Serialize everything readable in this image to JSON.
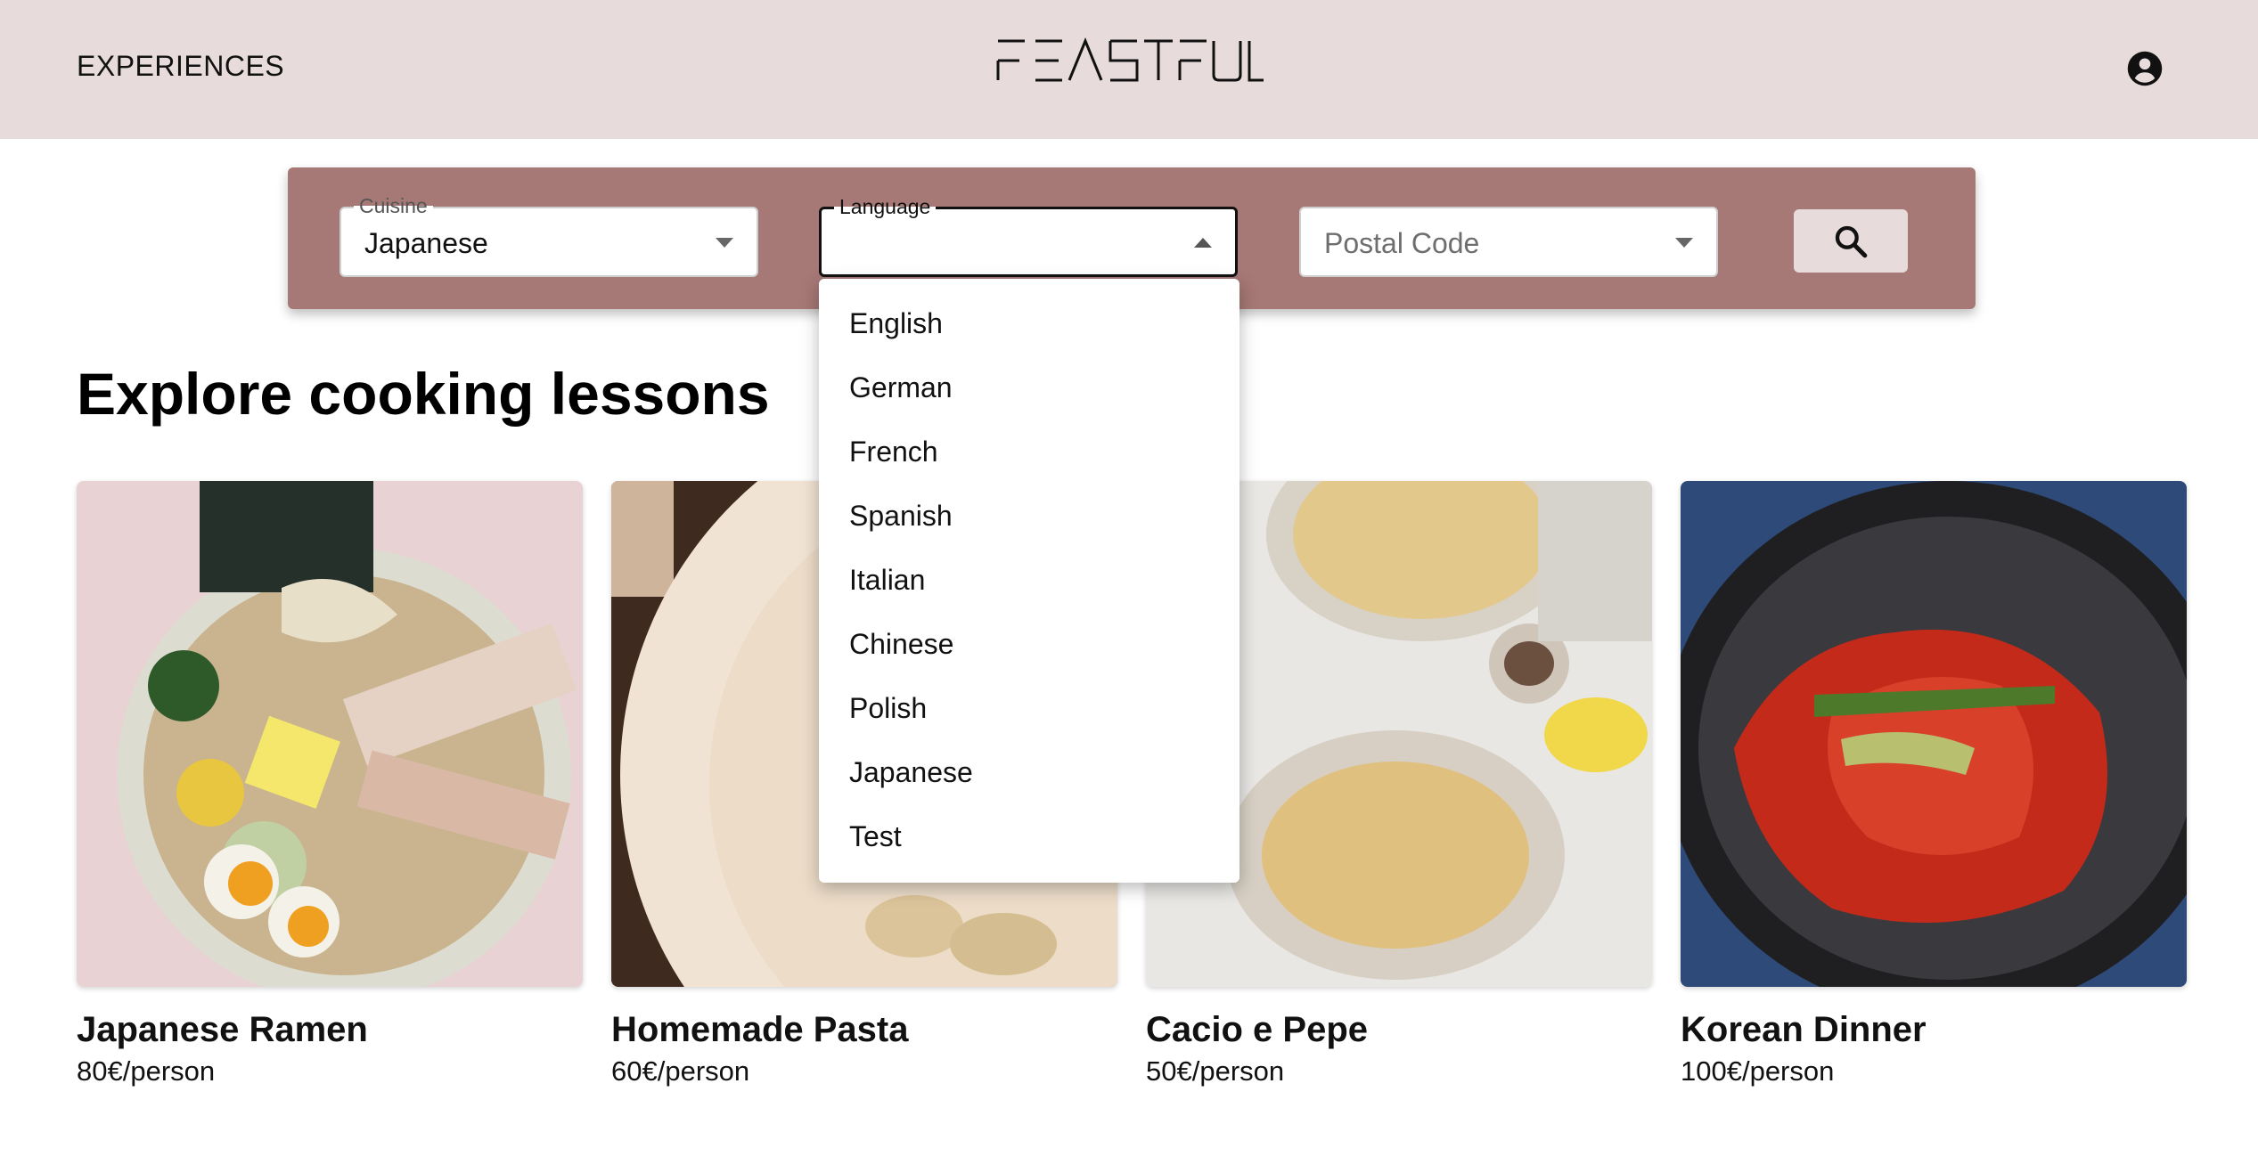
{
  "header": {
    "nav_link": "EXPERIENCES",
    "logo_text": "FEASTFUL",
    "account_icon": "account-circle-icon"
  },
  "search": {
    "cuisine": {
      "label": "Cuisine",
      "value": "Japanese"
    },
    "language": {
      "label": "Language",
      "value": ""
    },
    "postal_code": {
      "placeholder": "Postal Code"
    },
    "search_icon": "search-icon"
  },
  "language_options": [
    "English",
    "German",
    "French",
    "Spanish",
    "Italian",
    "Chinese",
    "Polish",
    "Japanese",
    "Test"
  ],
  "main": {
    "title": "Explore cooking lessons"
  },
  "cards": [
    {
      "title": "Japanese Ramen",
      "price": "80€/person"
    },
    {
      "title": "Homemade Pasta",
      "price": "60€/person"
    },
    {
      "title": "Cacio e Pepe",
      "price": "50€/person"
    },
    {
      "title": "Korean Dinner",
      "price": "100€/person"
    }
  ],
  "colors": {
    "header_bg": "#e7dcdb",
    "search_bar_bg": "#a67876"
  }
}
